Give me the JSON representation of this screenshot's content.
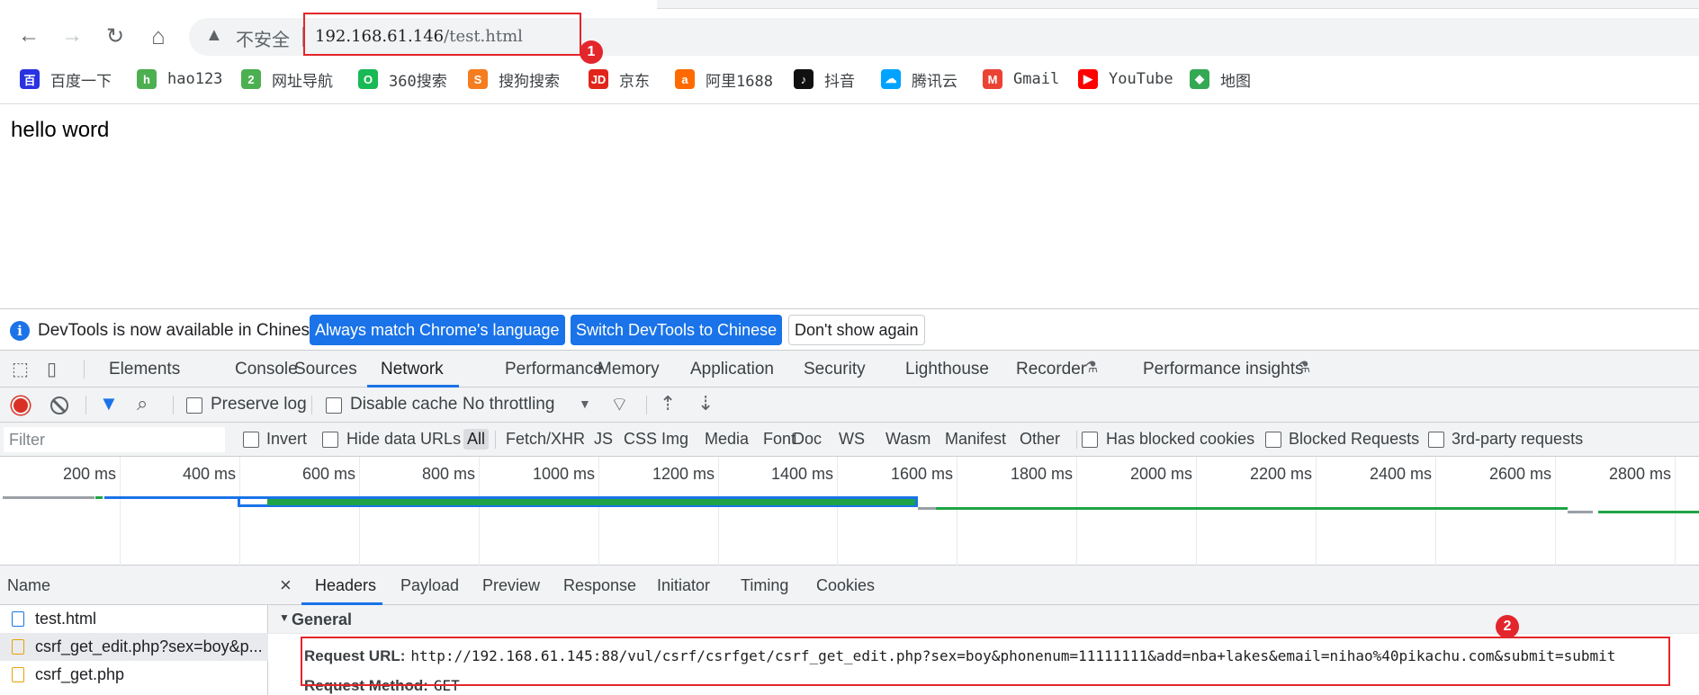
{
  "browser": {
    "nav": {
      "back_icon": "←",
      "forward_icon": "→",
      "reload_icon": "↻",
      "home_icon": "⌂"
    },
    "address": {
      "security_label": "不安全",
      "host": "192.168.61.146",
      "path": "/test.html"
    },
    "annotations": {
      "badge1": "1",
      "badge2": "2"
    },
    "bookmarks": [
      {
        "label": "百度一下",
        "icon": "baidu-icon",
        "color": "#2932e1",
        "glyph": "百"
      },
      {
        "label": "hao123",
        "icon": "hao123-icon",
        "color": "#4caf50",
        "glyph": "h"
      },
      {
        "label": "网址导航",
        "icon": "2345-icon",
        "color": "#4caf50",
        "glyph": "2"
      },
      {
        "label": "360搜索",
        "icon": "360-icon",
        "color": "#19b955",
        "glyph": "O"
      },
      {
        "label": "搜狗搜索",
        "icon": "sogou-icon",
        "color": "#f57c1f",
        "glyph": "S"
      },
      {
        "label": "京东",
        "icon": "jd-icon",
        "color": "#e1251b",
        "glyph": "JD"
      },
      {
        "label": "阿里1688",
        "icon": "alibaba-icon",
        "color": "#ff6a00",
        "glyph": "a"
      },
      {
        "label": "抖音",
        "icon": "douyin-icon",
        "color": "#111111",
        "glyph": "♪"
      },
      {
        "label": "腾讯云",
        "icon": "tencent-cloud-icon",
        "color": "#00a3ff",
        "glyph": "☁"
      },
      {
        "label": "Gmail",
        "icon": "gmail-icon",
        "color": "#ea4335",
        "glyph": "M"
      },
      {
        "label": "YouTube",
        "icon": "youtube-icon",
        "color": "#ff0000",
        "glyph": "▶"
      },
      {
        "label": "地图",
        "icon": "maps-icon",
        "color": "#34a853",
        "glyph": "◆"
      }
    ]
  },
  "page": {
    "body_text": "hello word"
  },
  "devtools": {
    "infobar": {
      "message": "DevTools is now available in Chinese!",
      "btn_match": "Always match Chrome's language",
      "btn_switch": "Switch DevTools to Chinese",
      "btn_dismiss": "Don't show again"
    },
    "tabs": [
      "Elements",
      "Console",
      "Sources",
      "Network",
      "Performance",
      "Memory",
      "Application",
      "Security",
      "Lighthouse",
      "Recorder",
      "Performance insights"
    ],
    "experimental_icon": "⚗",
    "network_toolbar": {
      "preserve_log": "Preserve log",
      "disable_cache": "Disable cache",
      "throttling": "No throttling"
    },
    "filter": {
      "placeholder": "Filter",
      "invert": "Invert",
      "hide_data_urls": "Hide data URLs",
      "types": [
        "All",
        "Fetch/XHR",
        "JS",
        "CSS",
        "Img",
        "Media",
        "Font",
        "Doc",
        "WS",
        "Wasm",
        "Manifest",
        "Other"
      ],
      "has_blocked_cookies": "Has blocked cookies",
      "blocked_requests": "Blocked Requests",
      "third_party": "3rd-party requests"
    },
    "timeline": {
      "ticks": [
        "200 ms",
        "400 ms",
        "600 ms",
        "800 ms",
        "1000 ms",
        "1200 ms",
        "1400 ms",
        "1600 ms",
        "1800 ms",
        "2000 ms",
        "2200 ms",
        "2400 ms",
        "2600 ms",
        "2800 ms"
      ]
    },
    "requests": {
      "header": "Name",
      "rows": [
        "test.html",
        "csrf_get_edit.php?sex=boy&p...",
        "csrf_get.php"
      ]
    },
    "details": {
      "close": "×",
      "tabs": [
        "Headers",
        "Payload",
        "Preview",
        "Response",
        "Initiator",
        "Timing",
        "Cookies"
      ],
      "general_label": "General",
      "request_url_key": "Request URL:",
      "request_url_value": "http://192.168.61.145:88/vul/csrf/csrfget/csrf_get_edit.php?sex=boy&phonenum=11111111&add=nba+lakes&email=nihao%40pikachu.com&submit=submit",
      "request_method_key": "Request Method:",
      "request_method_value": "GET"
    }
  }
}
